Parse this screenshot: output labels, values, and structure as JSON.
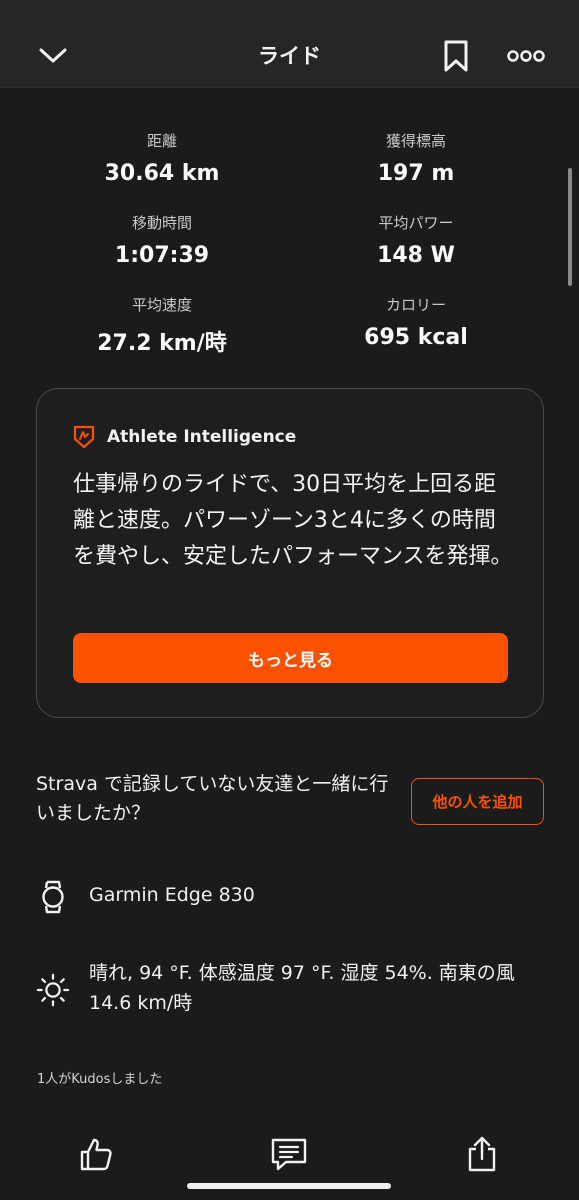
{
  "header": {
    "title": "ライド"
  },
  "stats": [
    {
      "label": "距離",
      "value": "30.64 km"
    },
    {
      "label": "獲得標高",
      "value": "197 m"
    },
    {
      "label": "移動時間",
      "value": "1:07:39"
    },
    {
      "label": "平均パワー",
      "value": "148 W"
    },
    {
      "label": "平均速度",
      "value": "27.2 km/時"
    },
    {
      "label": "カロリー",
      "value": "695 kcal"
    }
  ],
  "ai_card": {
    "title": "Athlete Intelligence",
    "text": "仕事帰りのライドで、30日平均を上回る距離と速度。パワーゾーン3と4に多くの時間を費やし、安定したパフォーマンスを発揮。",
    "button_label": "もっと見る"
  },
  "friends": {
    "prompt": "Strava で記録していない友達と一緒に行いましたか？",
    "button_label": "他の人を追加"
  },
  "device": {
    "name": "Garmin Edge 830",
    "icon": "watch-icon"
  },
  "weather": {
    "text": "晴れ, 94 °F. 体感温度 97 °F. 湿度 54%. 南東の風 14.6 km/時",
    "icon": "sun-icon"
  },
  "kudos": {
    "text": "1人がKudosしました"
  },
  "colors": {
    "accent": "#fc5200",
    "background": "#1b1b1b",
    "header": "#262626"
  }
}
